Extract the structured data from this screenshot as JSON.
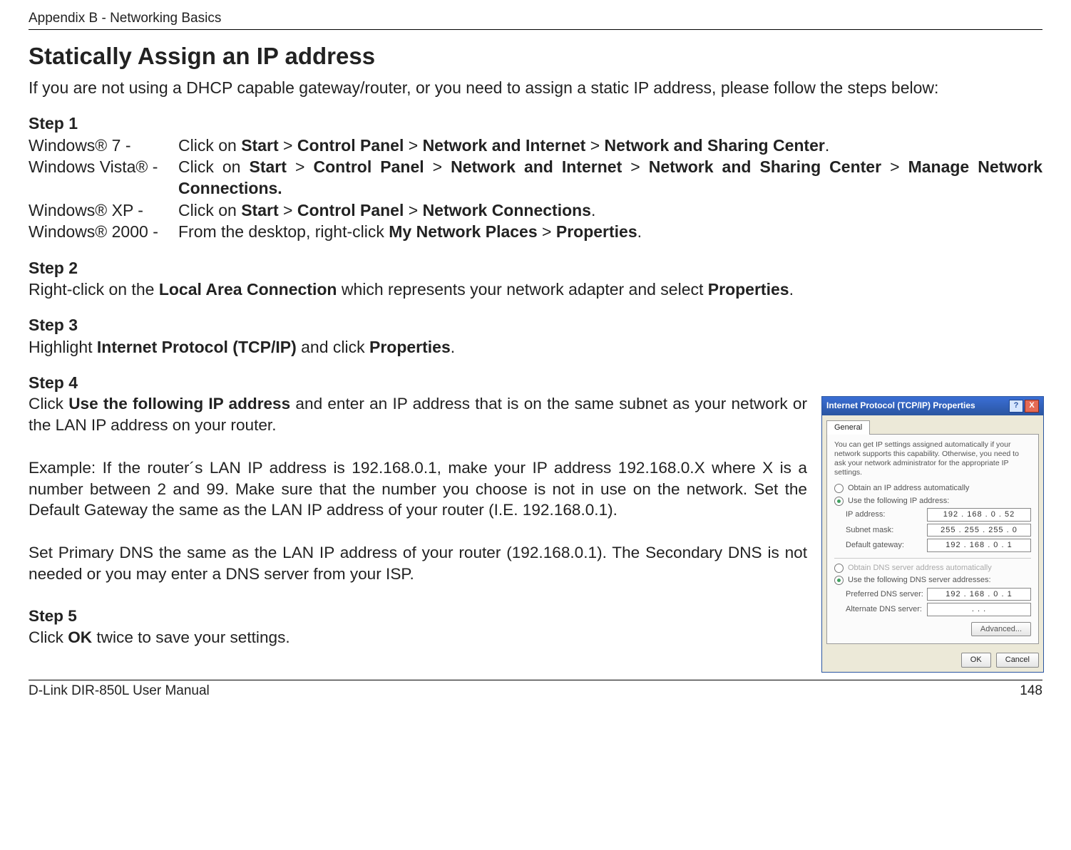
{
  "header": {
    "appendix": "Appendix B - Networking Basics"
  },
  "title": "Statically Assign an IP address",
  "intro": "If you are not using a DHCP capable gateway/router, or you need to assign a static IP address, please follow the steps below:",
  "step1": {
    "label": "Step 1",
    "rows": [
      {
        "os": "Windows® 7 -",
        "pre": "Click on ",
        "b1": "Start",
        "sep1": " > ",
        "b2": "Control Panel",
        "sep2": " > ",
        "b3": "Network and Internet",
        "sep3": " > ",
        "b4": "Network and Sharing Center",
        "post": "."
      },
      {
        "os": "Windows Vista® -",
        "pre": "Click on ",
        "b1": "Start",
        "sep1": " > ",
        "b2": "Control Panel",
        "sep2": " > ",
        "b3": "Network and Internet",
        "sep3": " > ",
        "b4": "Network and Sharing Center",
        "sep4": " > ",
        "b5": "Manage Network Connections.",
        "post": ""
      },
      {
        "os": "Windows® XP -",
        "pre": "Click on ",
        "b1": "Start",
        "sep1": " > ",
        "b2": "Control Panel",
        "sep2": " > ",
        "b3": "Network Connections",
        "post": "."
      },
      {
        "os": "Windows® 2000 -",
        "pre": "From the desktop, right-click ",
        "b1": "My Network Places",
        "sep1": " > ",
        "b2": "Properties",
        "post": "."
      }
    ]
  },
  "step2": {
    "label": "Step 2",
    "pre": "Right-click on the ",
    "b1": "Local Area Connection",
    "mid": " which represents your network adapter and select ",
    "b2": "Properties",
    "post": "."
  },
  "step3": {
    "label": "Step 3",
    "pre": "Highlight ",
    "b1": "Internet Protocol (TCP/IP)",
    "mid": " and click ",
    "b2": "Properties",
    "post": "."
  },
  "step4": {
    "label": "Step 4",
    "p1_pre": "Click ",
    "p1_b": "Use the following IP address",
    "p1_post": " and enter an IP address that is on the same subnet as your network or the LAN IP address on your router.",
    "p2": "Example: If the router´s LAN IP address is 192.168.0.1, make your IP address 192.168.0.X where X is a number between 2 and 99. Make sure that the number you choose is not in use on the network. Set the Default Gateway the same as the LAN IP address of your router (I.E. 192.168.0.1).",
    "p3": "Set Primary DNS the same as the LAN IP address of your router (192.168.0.1). The Secondary DNS is not needed or you may enter a DNS server from your ISP."
  },
  "step5": {
    "label": "Step 5",
    "pre": "Click ",
    "b1": "OK",
    "post": " twice to save your settings."
  },
  "footer": {
    "left": "D-Link DIR-850L User Manual",
    "right": "148"
  },
  "dialog": {
    "title": "Internet Protocol (TCP/IP) Properties",
    "help": "?",
    "close": "X",
    "tab": "General",
    "desc": "You can get IP settings assigned automatically if your network supports this capability. Otherwise, you need to ask your network administrator for the appropriate IP settings.",
    "radio_auto": "Obtain an IP address automatically",
    "radio_manual": "Use the following IP address:",
    "lbl_ip": "IP address:",
    "val_ip": "192 . 168 .  0  .  52",
    "lbl_mask": "Subnet mask:",
    "val_mask": "255 . 255 . 255 .  0",
    "lbl_gw": "Default gateway:",
    "val_gw": "192 . 168 .  0  .   1",
    "radio_dns_auto": "Obtain DNS server address automatically",
    "radio_dns_manual": "Use the following DNS server addresses:",
    "lbl_dns1": "Preferred DNS server:",
    "val_dns1": "192 . 168 .  0  .   1",
    "lbl_dns2": "Alternate DNS server:",
    "val_dns2": " .       .       .",
    "btn_adv": "Advanced...",
    "btn_ok": "OK",
    "btn_cancel": "Cancel"
  }
}
